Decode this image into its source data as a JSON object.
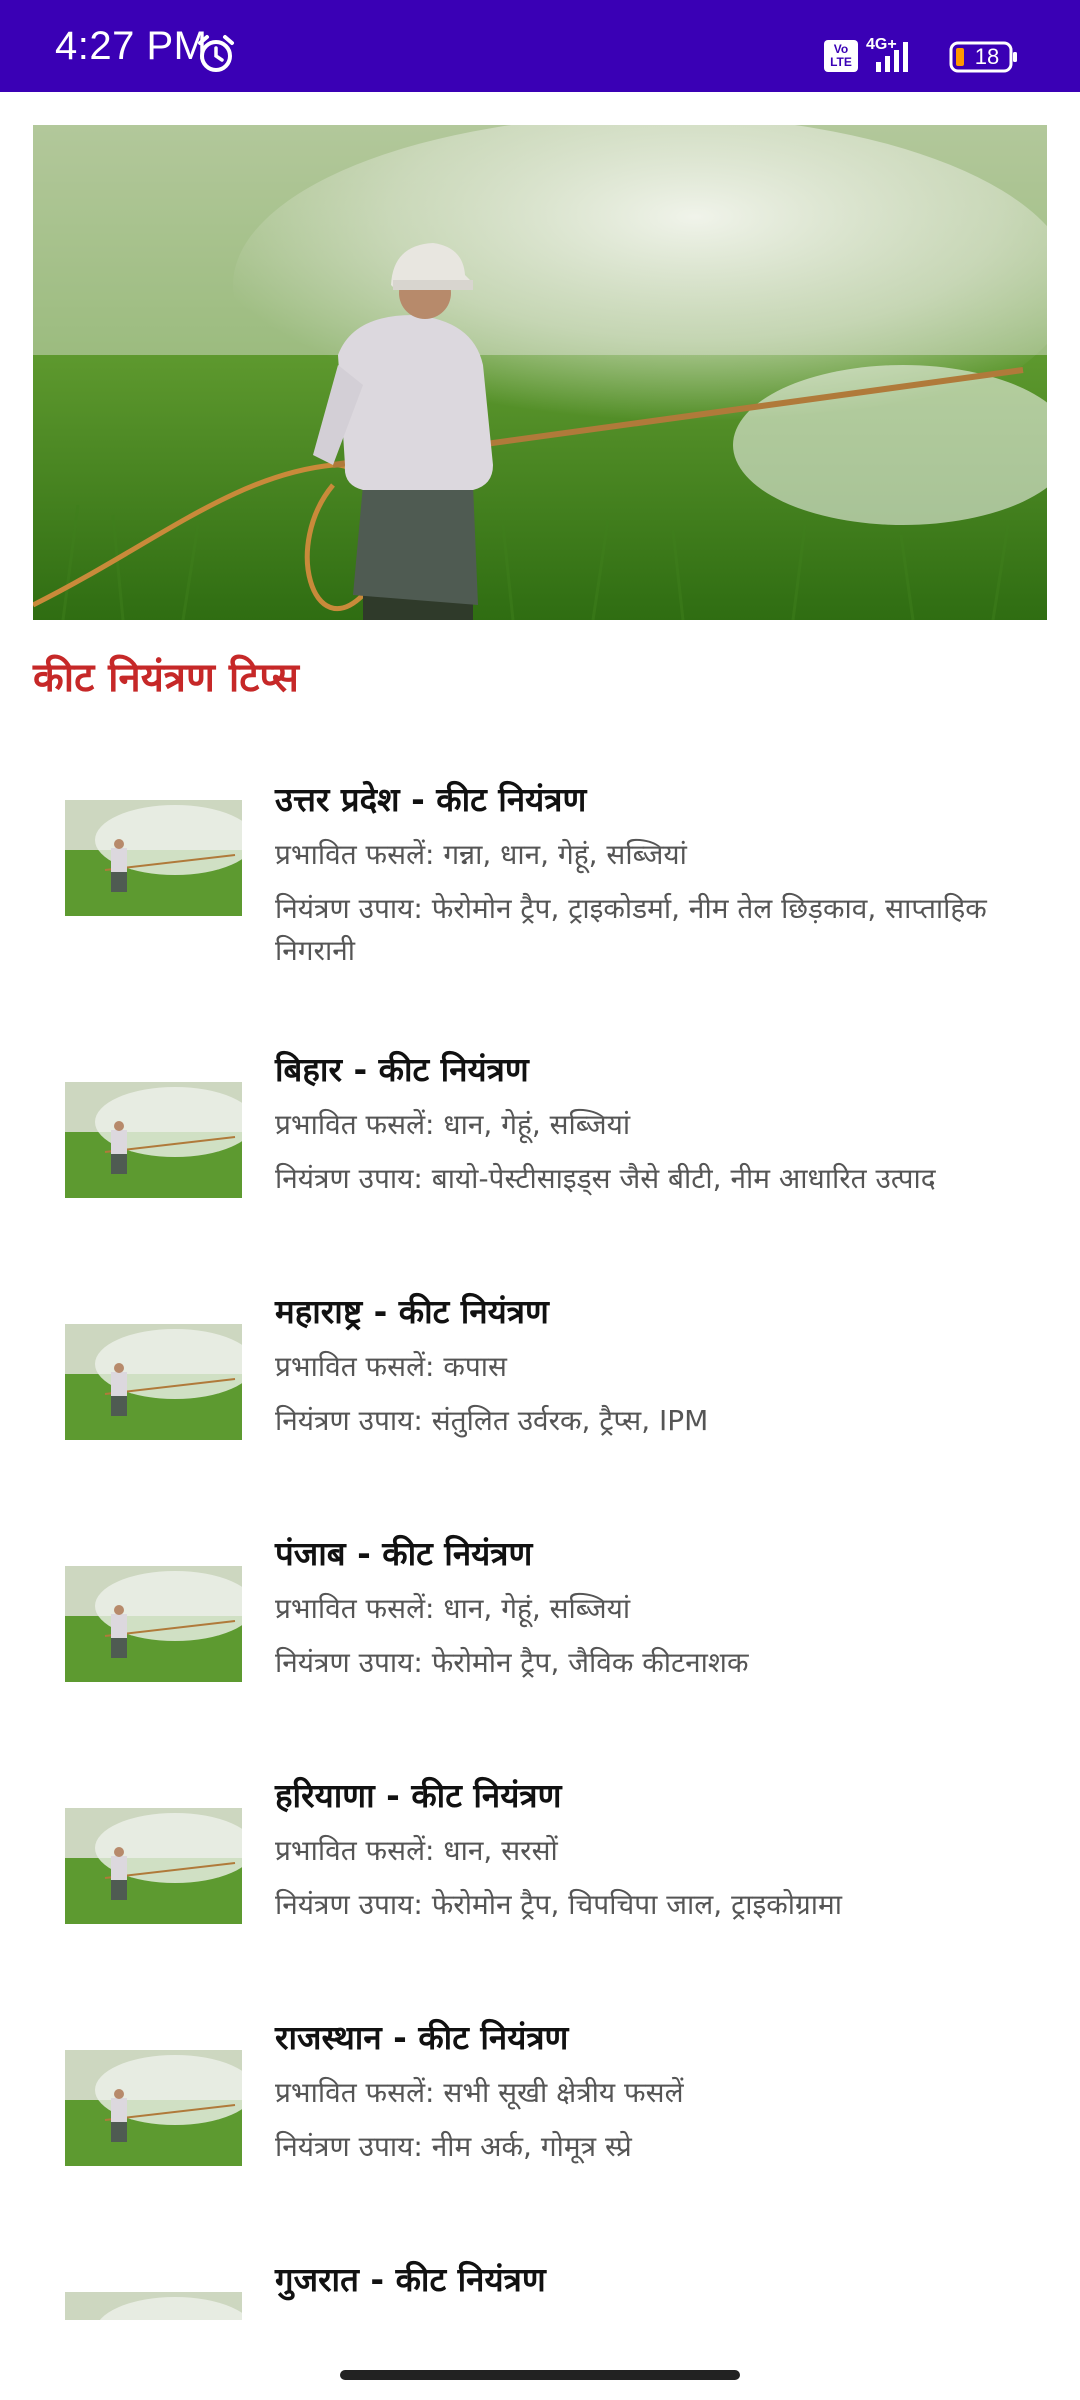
{
  "status_bar": {
    "time": "4:27 PM",
    "volte": "Vo LTE",
    "network": "4G+",
    "battery": "18"
  },
  "hero": {
    "image": "farmer-spraying-pesticide-photo"
  },
  "section": {
    "title": "कीट नियंत्रण टिप्स"
  },
  "items": [
    {
      "title": "उत्तर प्रदेश - कीट नियंत्रण",
      "crops": "प्रभावित फसलें: गन्ना, धान, गेहूं, सब्जियां",
      "measures": "नियंत्रण उपाय: फेरोमोन ट्रैप, ट्राइकोडर्मा, नीम तेल छिड़काव, साप्ताहिक निगरानी"
    },
    {
      "title": "बिहार - कीट नियंत्रण",
      "crops": "प्रभावित फसलें: धान, गेहूं, सब्जियां",
      "measures": "नियंत्रण उपाय: बायो-पेस्टीसाइड्स जैसे बीटी, नीम आधारित उत्पाद"
    },
    {
      "title": "महाराष्ट्र - कीट नियंत्रण",
      "crops": "प्रभावित फसलें: कपास",
      "measures": "नियंत्रण उपाय: संतुलित उर्वरक, ट्रैप्स, IPM"
    },
    {
      "title": "पंजाब - कीट नियंत्रण",
      "crops": "प्रभावित फसलें: धान, गेहूं, सब्जियां",
      "measures": "नियंत्रण उपाय: फेरोमोन ट्रैप, जैविक कीटनाशक"
    },
    {
      "title": "हरियाणा - कीट नियंत्रण",
      "crops": "प्रभावित फसलें: धान, सरसों",
      "measures": "नियंत्रण उपाय: फेरोमोन ट्रैप, चिपचिपा जाल, ट्राइकोग्रामा"
    },
    {
      "title": "राजस्थान - कीट नियंत्रण",
      "crops": "प्रभावित फसलें: सभी सूखी क्षेत्रीय फसलें",
      "measures": "नियंत्रण उपाय: नीम अर्क, गोमूत्र स्प्रे"
    },
    {
      "title": "गुजरात - कीट नियंत्रण",
      "crops": "",
      "measures": ""
    }
  ],
  "colors": {
    "status_bar": "#3a00b5",
    "section_title": "#c62828",
    "body_text": "#555555"
  }
}
